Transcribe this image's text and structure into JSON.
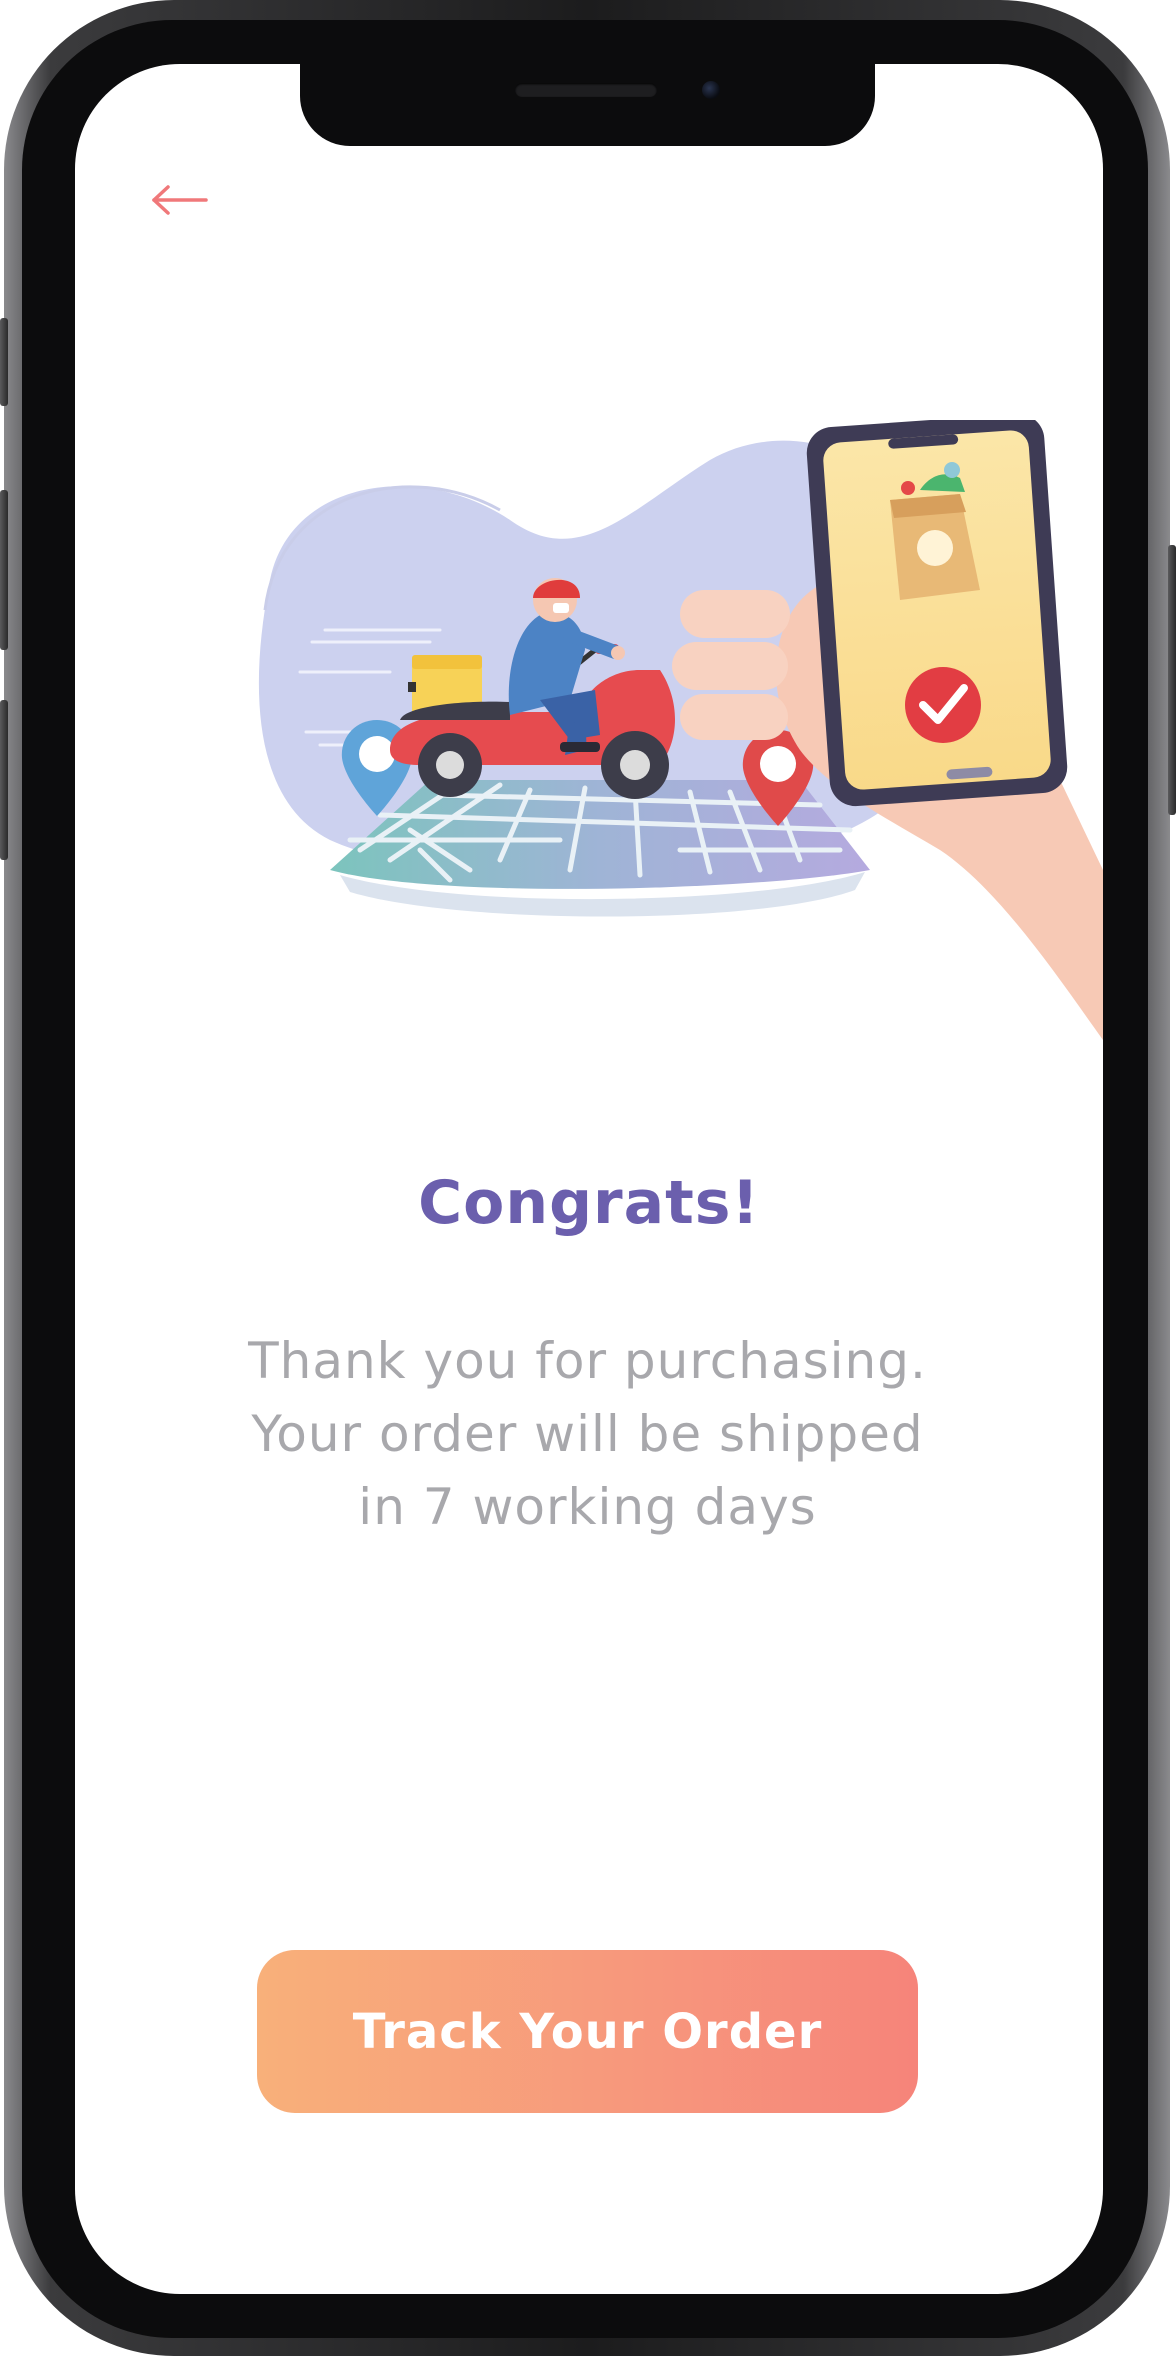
{
  "navigation": {
    "back_icon": "arrow-left-icon"
  },
  "illustration": {
    "description_icon": "delivery-scooter-illustration"
  },
  "content": {
    "title": "Congrats!",
    "message_lines": [
      "Thank you for purchasing.",
      "Your order will be shipped",
      "in 7 working days"
    ]
  },
  "actions": {
    "track_label": "Track Your Order"
  },
  "colors": {
    "accent": "#f6847a",
    "title": "#6b5fad",
    "body_text": "#a8a8ac",
    "button_gradient_start": "#f8b07a",
    "button_gradient_end": "#f6847a"
  }
}
